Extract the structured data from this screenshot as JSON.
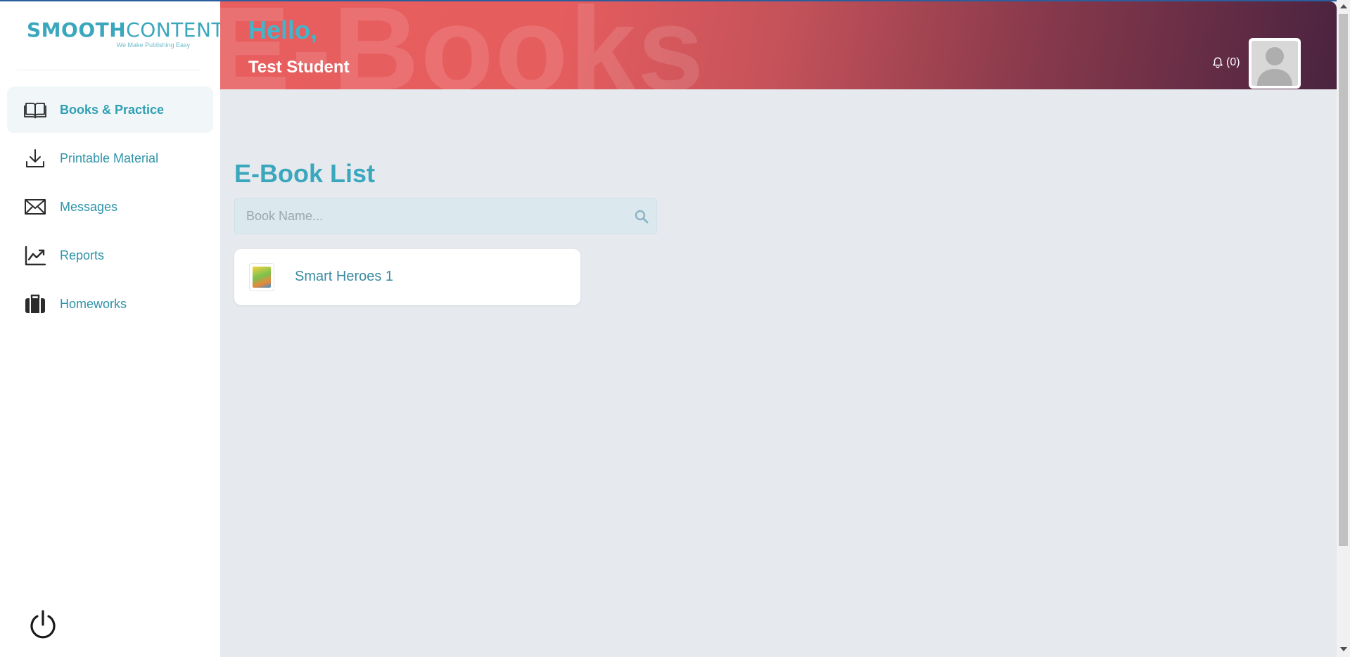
{
  "brand": {
    "name_bold": "SMOOTH",
    "name_thin": "CONTENT",
    "tagline": "We Make Publishing Easy"
  },
  "sidebar": {
    "items": [
      {
        "label": "Books & Practice",
        "icon": "book-open-icon",
        "active": true
      },
      {
        "label": "Printable Material",
        "icon": "download-icon",
        "active": false
      },
      {
        "label": "Messages",
        "icon": "envelope-icon",
        "active": false
      },
      {
        "label": "Reports",
        "icon": "chart-line-icon",
        "active": false
      },
      {
        "label": "Homeworks",
        "icon": "briefcase-icon",
        "active": false
      }
    ],
    "logout_icon": "power-icon"
  },
  "header": {
    "watermark": "E-Books",
    "greeting": "Hello,",
    "user_name": "Test Student",
    "notifications": "(0)"
  },
  "main": {
    "title": "E-Book List",
    "search": {
      "placeholder": "Book Name...",
      "value": ""
    },
    "books": [
      {
        "title": "Smart Heroes 1"
      }
    ]
  },
  "colors": {
    "accent": "#3aa7bd",
    "header_start": "#e85e5f",
    "header_end": "#4a2340",
    "content_bg": "#e6eaee"
  }
}
